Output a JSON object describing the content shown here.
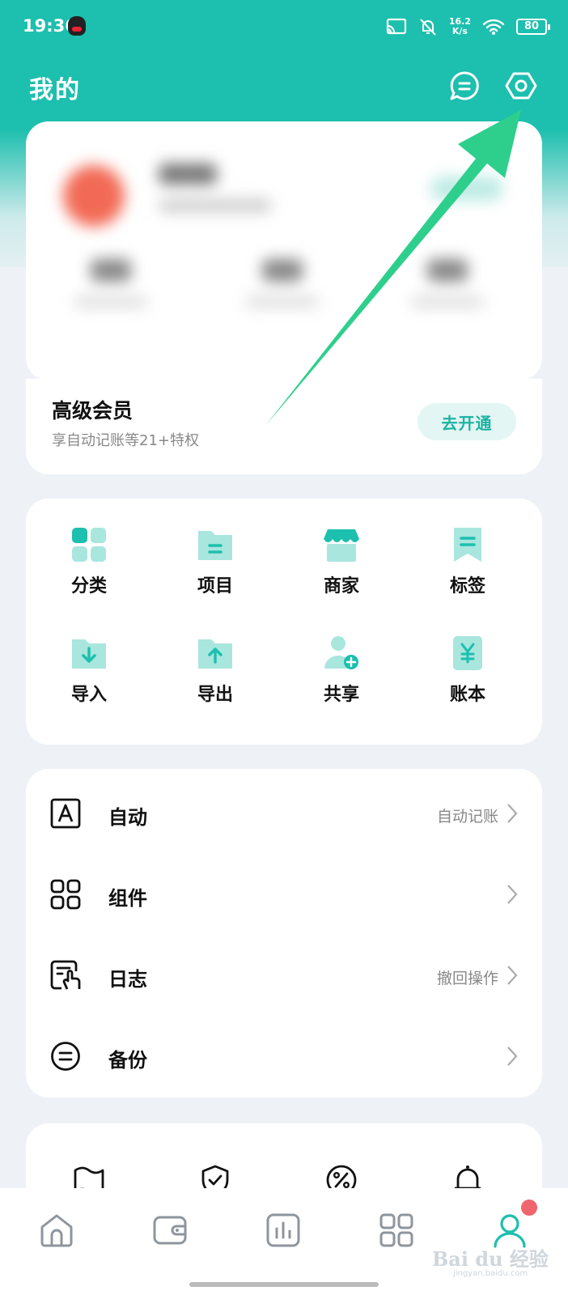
{
  "status_bar": {
    "time": "19:36",
    "net_speed": "16.2",
    "net_unit": "K/s",
    "battery": "80"
  },
  "header": {
    "title": "我的"
  },
  "vip": {
    "title": "高级会员",
    "subtitle": "享自动记账等21+特权",
    "button": "去开通"
  },
  "grid": [
    {
      "label": "分类",
      "icon": "category-icon"
    },
    {
      "label": "项目",
      "icon": "project-icon"
    },
    {
      "label": "商家",
      "icon": "store-icon"
    },
    {
      "label": "标签",
      "icon": "tag-icon"
    },
    {
      "label": "导入",
      "icon": "import-icon"
    },
    {
      "label": "导出",
      "icon": "export-icon"
    },
    {
      "label": "共享",
      "icon": "share-user-icon"
    },
    {
      "label": "账本",
      "icon": "ledger-icon"
    }
  ],
  "list": [
    {
      "label": "自动",
      "right": "自动记账",
      "icon": "auto-a-icon"
    },
    {
      "label": "组件",
      "right": "",
      "icon": "widgets-icon"
    },
    {
      "label": "日志",
      "right": "撤回操作",
      "icon": "log-icon"
    },
    {
      "label": "备份",
      "right": "",
      "icon": "backup-icon"
    }
  ],
  "partial_icons": [
    "flag-icon",
    "shield-check-icon",
    "percent-icon",
    "bell-icon"
  ],
  "tabs": [
    "home-icon",
    "wallet-icon",
    "chart-icon",
    "apps-icon",
    "profile-icon"
  ],
  "watermark": {
    "main": "Bai du 经验",
    "sub": "jingyan.baidu.com"
  },
  "colors": {
    "accent": "#1dbfae",
    "accent_light": "#a8e6de",
    "arrow": "#2ecf8c",
    "badge": "#f0656d"
  }
}
